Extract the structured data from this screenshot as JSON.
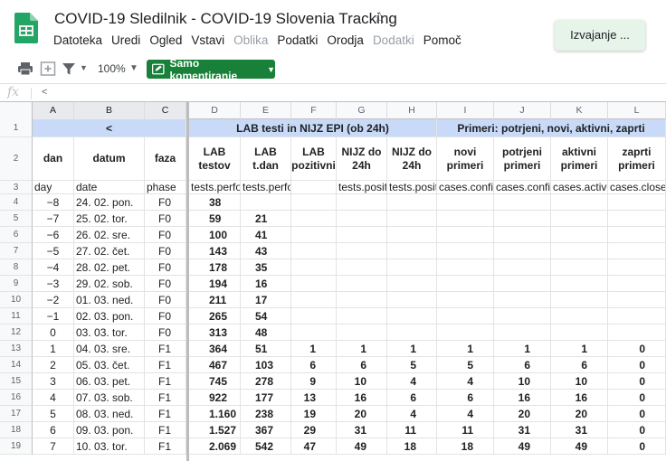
{
  "header": {
    "title": "COVID-19 Sledilnik - COVID-19 Slovenia Tracking",
    "running_toast": "Izvajanje ...",
    "menu": [
      {
        "label": "Datoteka",
        "disabled": false
      },
      {
        "label": "Uredi",
        "disabled": false
      },
      {
        "label": "Ogled",
        "disabled": false
      },
      {
        "label": "Vstavi",
        "disabled": false
      },
      {
        "label": "Oblika",
        "disabled": true
      },
      {
        "label": "Podatki",
        "disabled": false
      },
      {
        "label": "Orodja",
        "disabled": false
      },
      {
        "label": "Dodatki",
        "disabled": true
      },
      {
        "label": "Pomoč",
        "disabled": false
      }
    ]
  },
  "toolbar": {
    "zoom": "100%",
    "mode_label": "Samo komentiranje",
    "icons": [
      "print-icon",
      "add-icon",
      "filter-icon",
      "dropdown-caret-icon"
    ]
  },
  "formula_bar": {
    "fx": "fx",
    "value": "<"
  },
  "columns": [
    "A",
    "B",
    "C",
    "D",
    "E",
    "F",
    "G",
    "H",
    "I",
    "J",
    "K",
    "L"
  ],
  "row_numbers": [
    "1",
    "2",
    "3",
    "4",
    "5",
    "6",
    "7",
    "8",
    "9",
    "10",
    "11",
    "12",
    "13",
    "14",
    "15",
    "16",
    "17",
    "18",
    "19"
  ],
  "banner": {
    "nav": "<",
    "lab": "LAB testi in NIJZ EPI (ob 24h)",
    "cases": "Primeri: potrjeni, novi, aktivni, zaprti"
  },
  "headers": {
    "A": "dan",
    "B": "datum",
    "C": "faza",
    "D": "LAB testov",
    "E": "LAB t.dan",
    "F": "LAB pozitivni",
    "G": "NIJZ do 24h",
    "H": "NIJZ do 24h",
    "I": "novi primeri",
    "J": "potrjeni primeri",
    "K": "aktivni primeri",
    "L": "zaprti primeri"
  },
  "keys": {
    "A": "day",
    "B": "date",
    "C": "phase",
    "D": "tests.perfo",
    "E": "tests.perfo",
    "F": "",
    "G": "tests.positi",
    "H": "tests.positi",
    "I": "cases.confir",
    "J": "cases.confir",
    "K": "cases.active",
    "L": "cases.close"
  },
  "rows": [
    [
      "−8",
      "24. 02. pon.",
      "F0",
      "38",
      "",
      "",
      "",
      "",
      "",
      "",
      "",
      ""
    ],
    [
      "−7",
      "25. 02. tor.",
      "F0",
      "59",
      "21",
      "",
      "",
      "",
      "",
      "",
      "",
      ""
    ],
    [
      "−6",
      "26. 02. sre.",
      "F0",
      "100",
      "41",
      "",
      "",
      "",
      "",
      "",
      "",
      ""
    ],
    [
      "−5",
      "27. 02. čet.",
      "F0",
      "143",
      "43",
      "",
      "",
      "",
      "",
      "",
      "",
      ""
    ],
    [
      "−4",
      "28. 02. pet.",
      "F0",
      "178",
      "35",
      "",
      "",
      "",
      "",
      "",
      "",
      ""
    ],
    [
      "−3",
      "29. 02. sob.",
      "F0",
      "194",
      "16",
      "",
      "",
      "",
      "",
      "",
      "",
      ""
    ],
    [
      "−2",
      "01. 03. ned.",
      "F0",
      "211",
      "17",
      "",
      "",
      "",
      "",
      "",
      "",
      ""
    ],
    [
      "−1",
      "02. 03. pon.",
      "F0",
      "265",
      "54",
      "",
      "",
      "",
      "",
      "",
      "",
      ""
    ],
    [
      "0",
      "03. 03. tor.",
      "F0",
      "313",
      "48",
      "",
      "",
      "",
      "",
      "",
      "",
      ""
    ],
    [
      "1",
      "04. 03. sre.",
      "F1",
      "364",
      "51",
      "1",
      "1",
      "1",
      "1",
      "1",
      "1",
      "0"
    ],
    [
      "2",
      "05. 03. čet.",
      "F1",
      "467",
      "103",
      "6",
      "6",
      "5",
      "5",
      "6",
      "6",
      "0"
    ],
    [
      "3",
      "06. 03. pet.",
      "F1",
      "745",
      "278",
      "9",
      "10",
      "4",
      "4",
      "10",
      "10",
      "0"
    ],
    [
      "4",
      "07. 03. sob.",
      "F1",
      "922",
      "177",
      "13",
      "16",
      "6",
      "6",
      "16",
      "16",
      "0"
    ],
    [
      "5",
      "08. 03. ned.",
      "F1",
      "1.160",
      "238",
      "19",
      "20",
      "4",
      "4",
      "20",
      "20",
      "0"
    ],
    [
      "6",
      "09. 03. pon.",
      "F1",
      "1.527",
      "367",
      "29",
      "31",
      "11",
      "11",
      "31",
      "31",
      "0"
    ],
    [
      "7",
      "10. 03. tor.",
      "F1",
      "2.069",
      "542",
      "47",
      "49",
      "18",
      "18",
      "49",
      "49",
      "0"
    ]
  ]
}
